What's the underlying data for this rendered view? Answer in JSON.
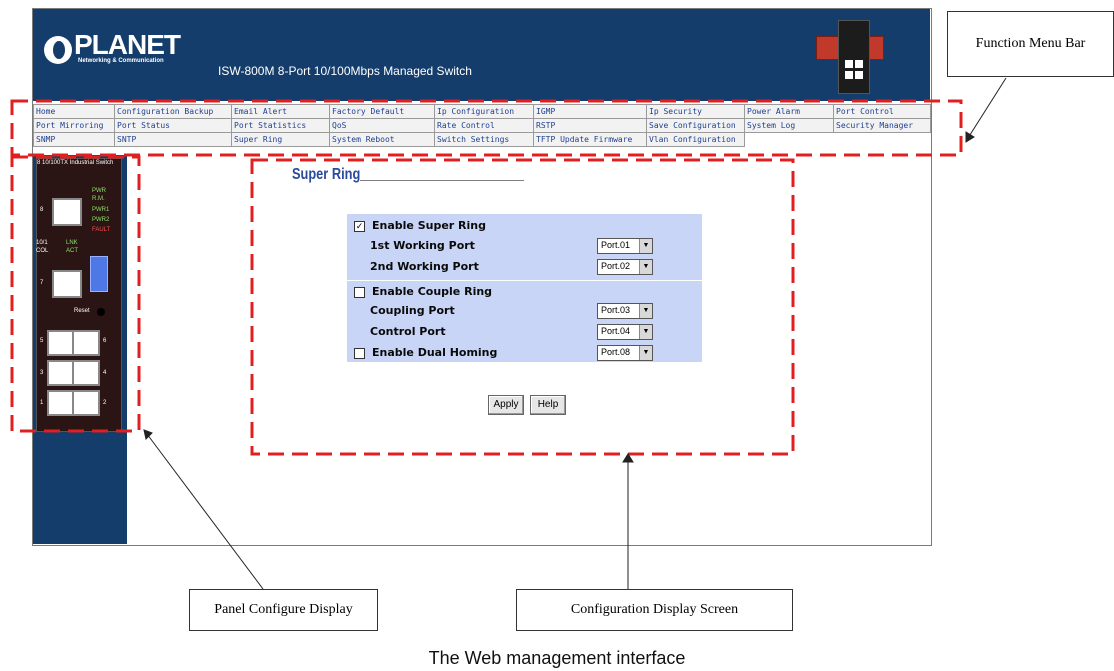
{
  "banner": {
    "logo_text": "PLANET",
    "logo_subtext": "Networking & Communication",
    "title": "ISW-800M 8-Port 10/100Mbps Managed Switch"
  },
  "menu": {
    "rows": [
      [
        "Home",
        "Configuration Backup",
        "Email Alert",
        "Factory Default",
        "Ip Configuration",
        "IGMP",
        "Ip Security",
        "Power Alarm",
        "Port Control"
      ],
      [
        "Port Mirroring",
        "Port Status",
        "Port Statistics",
        "QoS",
        "Rate Control",
        "RSTP",
        "Save Configuration",
        "System Log",
        "Security Manager"
      ],
      [
        "SNMP",
        "SNTP",
        "Super Ring",
        "System Reboot",
        "Switch Settings",
        "TFTP Update Firmware",
        "Vlan Configuration",
        "",
        ""
      ]
    ]
  },
  "panel": {
    "title": "8 10/100TX Industrial Switch",
    "led_labels": [
      "PWR",
      "R.M.",
      "PWR1",
      "PWR2",
      "FAULT"
    ],
    "port_led_labels": [
      "10/1",
      "LNK",
      "COL",
      "ACT"
    ],
    "reset_label": "Reset",
    "port_numbers": [
      "8",
      "7",
      "5",
      "6",
      "3",
      "4",
      "1",
      "2"
    ]
  },
  "content": {
    "title": "Super Ring",
    "enable_super_ring": {
      "label": "Enable Super Ring",
      "checked": true
    },
    "first_working_port": {
      "label": "1st Working Port",
      "value": "Port.01"
    },
    "second_working_port": {
      "label": "2nd Working Port",
      "value": "Port.02"
    },
    "enable_couple_ring": {
      "label": "Enable Couple Ring",
      "checked": false
    },
    "coupling_port": {
      "label": "Coupling Port",
      "value": "Port.03"
    },
    "control_port": {
      "label": "Control Port",
      "value": "Port.04"
    },
    "enable_dual_homing": {
      "label": "Enable Dual Homing",
      "checked": false,
      "value": "Port.08"
    },
    "apply_label": "Apply",
    "help_label": "Help"
  },
  "annotations": {
    "function_menu_bar": "Function Menu Bar",
    "panel_configure_display": "Panel Configure Display",
    "configuration_display_screen": "Configuration Display Screen"
  },
  "caption": "The Web management interface",
  "colors": {
    "banner": "#143d6b",
    "form_background": "#c9d5f7",
    "annotation_dash": "#e02020",
    "menu_text": "#1f3f8f"
  }
}
